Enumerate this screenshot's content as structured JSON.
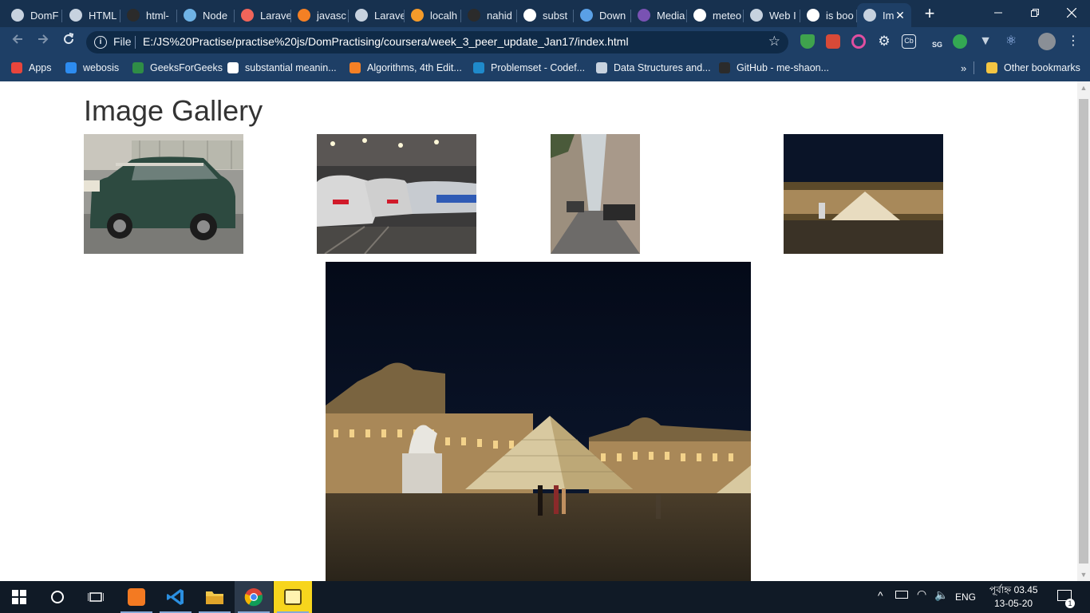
{
  "browser": {
    "tabs": [
      {
        "title": "DomF",
        "icon": "globe-icon",
        "color": "#c7d2df"
      },
      {
        "title": "HTML",
        "icon": "globe-icon",
        "color": "#c7d2df"
      },
      {
        "title": "html-",
        "icon": "github-icon",
        "color": "#2b2b2b"
      },
      {
        "title": "Node",
        "icon": "node-icon",
        "color": "#6fb3e6"
      },
      {
        "title": "Larave",
        "icon": "laravel-icon",
        "color": "#f0655a"
      },
      {
        "title": "javasc",
        "icon": "stackoverflow-icon",
        "color": "#f48024"
      },
      {
        "title": "Larave",
        "icon": "globe-icon",
        "color": "#c7d2df"
      },
      {
        "title": "localh",
        "icon": "xampp-icon",
        "color": "#f59b2a"
      },
      {
        "title": "nahid",
        "icon": "github-icon",
        "color": "#2b2b2b"
      },
      {
        "title": "subst",
        "icon": "google-icon",
        "color": "#ffffff"
      },
      {
        "title": "Down",
        "icon": "link-icon",
        "color": "#5aa0e6"
      },
      {
        "title": "Media",
        "icon": "bootstrap-icon",
        "color": "#7952b3"
      },
      {
        "title": "meteo",
        "icon": "google-icon",
        "color": "#ffffff"
      },
      {
        "title": "Web I",
        "icon": "globe-icon",
        "color": "#c7d2df"
      },
      {
        "title": "is boo",
        "icon": "google-icon",
        "color": "#ffffff"
      },
      {
        "title": "Im",
        "icon": "globe-icon",
        "color": "#c7d2df",
        "active": true
      }
    ],
    "address": {
      "scheme_label": "File",
      "url": "E:/JS%20Practise/practise%20js/DomPractising/coursera/week_3_peer_update_Jan17/index.html"
    },
    "bookmarks": [
      {
        "label": "Apps",
        "icon": "apps-grid-icon",
        "color": "#e8453c"
      },
      {
        "label": "webosis",
        "icon": "webosis-icon",
        "color": "#2d8cf0"
      },
      {
        "label": "GeeksForGeeks",
        "icon": "gfg-icon",
        "color": "#2f8d46"
      },
      {
        "label": "substantial meanin...",
        "icon": "google-icon",
        "color": "#ffffff"
      },
      {
        "label": "Algorithms, 4th Edit...",
        "icon": "princeton-icon",
        "color": "#f58025"
      },
      {
        "label": "Problemset - Codef...",
        "icon": "codeforces-icon",
        "color": "#1f8acb"
      },
      {
        "label": "Data Structures and...",
        "icon": "globe-icon",
        "color": "#c7d2df"
      },
      {
        "label": "GitHub - me-shaon...",
        "icon": "github-icon",
        "color": "#2b2b2b"
      }
    ],
    "bookmarks_overflow": "»",
    "other_bookmarks": "Other bookmarks"
  },
  "page": {
    "title": "Image Gallery",
    "thumbnails": [
      {
        "alt": "Green Mini car parked on street",
        "name": "thumb-mini-car"
      },
      {
        "alt": "TGV trains at Paris station",
        "name": "thumb-trains"
      },
      {
        "alt": "Narrow Paris street with parked cars",
        "name": "thumb-street"
      },
      {
        "alt": "Louvre pyramid at night",
        "name": "thumb-louvre"
      }
    ],
    "featured_alt": "Louvre pyramid at night"
  },
  "taskbar": {
    "language": "ENG",
    "time": "পূর্বাহ্ন 03.45",
    "date": "13-05-20",
    "notification_count": "1"
  },
  "colors": {
    "chrome_bg": "#1e3f66",
    "tabstrip_bg": "#17314f",
    "taskbar_bg": "#101a26",
    "title_text": "#333333"
  }
}
